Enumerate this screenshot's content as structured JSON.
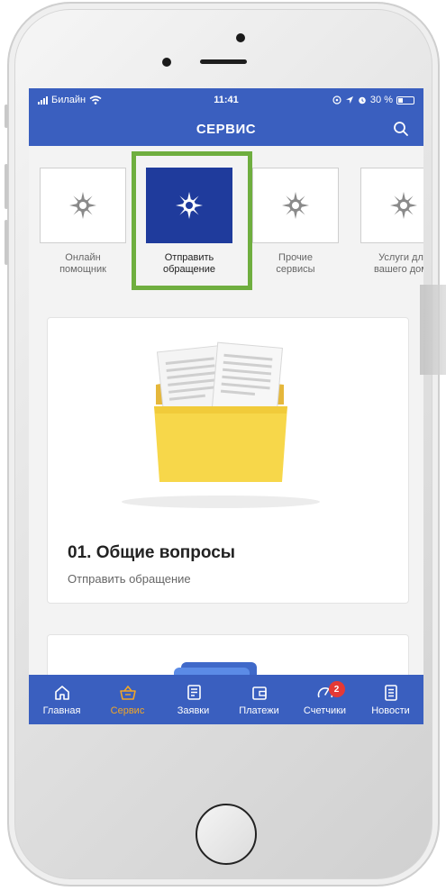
{
  "status_bar": {
    "carrier": "Билайн",
    "time": "11:41",
    "battery": "30 %"
  },
  "header": {
    "title": "СЕРВИС"
  },
  "services": [
    {
      "line1": "Онлайн",
      "line2": "помощник"
    },
    {
      "line1": "Отправить",
      "line2": "обращение"
    },
    {
      "line1": "Прочие",
      "line2": "сервисы"
    },
    {
      "line1": "Услуги для",
      "line2": "вашего дома"
    }
  ],
  "cards": [
    {
      "title": "01. Общие вопросы",
      "subtitle": "Отправить обращение"
    }
  ],
  "tabbar": {
    "items": [
      {
        "label": "Главная"
      },
      {
        "label": "Сервис"
      },
      {
        "label": "Заявки"
      },
      {
        "label": "Платежи"
      },
      {
        "label": "Счетчики",
        "badge": "2"
      },
      {
        "label": "Новости"
      }
    ]
  },
  "colors": {
    "primary": "#3a5fbf",
    "active_tab": "#f2a626",
    "highlight": "#6fae3f",
    "service_active": "#1f3b9c",
    "badge": "#e53935"
  }
}
